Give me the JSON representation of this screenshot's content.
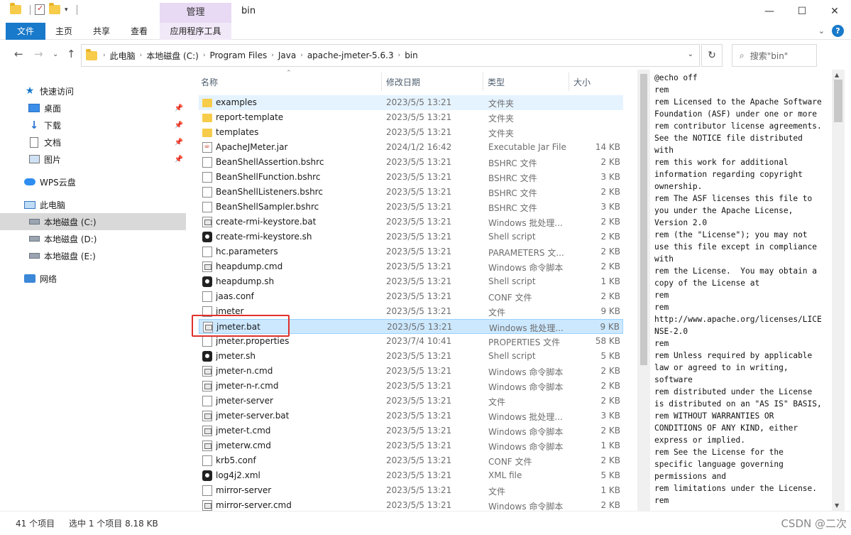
{
  "window": {
    "title": "bin",
    "manage_tab": "管理",
    "controls": {
      "minimize": "—",
      "maximize": "☐",
      "close": "✕"
    }
  },
  "ribbon": {
    "tabs": [
      "文件",
      "主页",
      "共享",
      "查看",
      "应用程序工具"
    ],
    "help": "?"
  },
  "address": {
    "crumbs": [
      "此电脑",
      "本地磁盘 (C:)",
      "Program Files",
      "Java",
      "apache-jmeter-5.6.3",
      "bin"
    ],
    "search_placeholder": "搜索\"bin\""
  },
  "sidebar": {
    "items": [
      {
        "label": "快速访问",
        "icon": "star-icon",
        "pinned": false
      },
      {
        "label": "桌面",
        "icon": "desktop-icon",
        "pinned": true
      },
      {
        "label": "下载",
        "icon": "download-icon",
        "pinned": true
      },
      {
        "label": "文档",
        "icon": "document-icon",
        "pinned": true
      },
      {
        "label": "图片",
        "icon": "picture-icon",
        "pinned": true
      },
      {
        "label": "WPS云盘",
        "icon": "cloud-icon",
        "pinned": false
      },
      {
        "label": "此电脑",
        "icon": "computer-icon",
        "pinned": false
      },
      {
        "label": "本地磁盘 (C:)",
        "icon": "drive-icon",
        "pinned": false
      },
      {
        "label": "本地磁盘 (D:)",
        "icon": "drive-icon",
        "pinned": false
      },
      {
        "label": "本地磁盘 (E:)",
        "icon": "drive-icon",
        "pinned": false
      },
      {
        "label": "网络",
        "icon": "network-icon",
        "pinned": false
      }
    ]
  },
  "columns": {
    "name": "名称",
    "date": "修改日期",
    "type": "类型",
    "size": "大小"
  },
  "files": [
    {
      "name": "examples",
      "date": "2023/5/5 13:21",
      "type": "文件夹",
      "size": "",
      "icon": "folder"
    },
    {
      "name": "report-template",
      "date": "2023/5/5 13:21",
      "type": "文件夹",
      "size": "",
      "icon": "folder"
    },
    {
      "name": "templates",
      "date": "2023/5/5 13:21",
      "type": "文件夹",
      "size": "",
      "icon": "folder"
    },
    {
      "name": "ApacheJMeter.jar",
      "date": "2024/1/2 16:42",
      "type": "Executable Jar File",
      "size": "14 KB",
      "icon": "jar"
    },
    {
      "name": "BeanShellAssertion.bshrc",
      "date": "2023/5/5 13:21",
      "type": "BSHRC 文件",
      "size": "2 KB",
      "icon": "file"
    },
    {
      "name": "BeanShellFunction.bshrc",
      "date": "2023/5/5 13:21",
      "type": "BSHRC 文件",
      "size": "3 KB",
      "icon": "file"
    },
    {
      "name": "BeanShellListeners.bshrc",
      "date": "2023/5/5 13:21",
      "type": "BSHRC 文件",
      "size": "2 KB",
      "icon": "file"
    },
    {
      "name": "BeanShellSampler.bshrc",
      "date": "2023/5/5 13:21",
      "type": "BSHRC 文件",
      "size": "3 KB",
      "icon": "file"
    },
    {
      "name": "create-rmi-keystore.bat",
      "date": "2023/5/5 13:21",
      "type": "Windows 批处理...",
      "size": "2 KB",
      "icon": "bat"
    },
    {
      "name": "create-rmi-keystore.sh",
      "date": "2023/5/5 13:21",
      "type": "Shell script",
      "size": "2 KB",
      "icon": "sh"
    },
    {
      "name": "hc.parameters",
      "date": "2023/5/5 13:21",
      "type": "PARAMETERS 文...",
      "size": "2 KB",
      "icon": "file"
    },
    {
      "name": "heapdump.cmd",
      "date": "2023/5/5 13:21",
      "type": "Windows 命令脚本",
      "size": "2 KB",
      "icon": "bat"
    },
    {
      "name": "heapdump.sh",
      "date": "2023/5/5 13:21",
      "type": "Shell script",
      "size": "1 KB",
      "icon": "sh"
    },
    {
      "name": "jaas.conf",
      "date": "2023/5/5 13:21",
      "type": "CONF 文件",
      "size": "2 KB",
      "icon": "file"
    },
    {
      "name": "jmeter",
      "date": "2023/5/5 13:21",
      "type": "文件",
      "size": "9 KB",
      "icon": "file"
    },
    {
      "name": "jmeter.bat",
      "date": "2023/5/5 13:21",
      "type": "Windows 批处理...",
      "size": "9 KB",
      "icon": "bat",
      "selected": true
    },
    {
      "name": "jmeter.properties",
      "date": "2023/7/4 10:41",
      "type": "PROPERTIES 文件",
      "size": "58 KB",
      "icon": "file"
    },
    {
      "name": "jmeter.sh",
      "date": "2023/5/5 13:21",
      "type": "Shell script",
      "size": "5 KB",
      "icon": "sh"
    },
    {
      "name": "jmeter-n.cmd",
      "date": "2023/5/5 13:21",
      "type": "Windows 命令脚本",
      "size": "2 KB",
      "icon": "bat"
    },
    {
      "name": "jmeter-n-r.cmd",
      "date": "2023/5/5 13:21",
      "type": "Windows 命令脚本",
      "size": "2 KB",
      "icon": "bat"
    },
    {
      "name": "jmeter-server",
      "date": "2023/5/5 13:21",
      "type": "文件",
      "size": "2 KB",
      "icon": "file"
    },
    {
      "name": "jmeter-server.bat",
      "date": "2023/5/5 13:21",
      "type": "Windows 批处理...",
      "size": "3 KB",
      "icon": "bat"
    },
    {
      "name": "jmeter-t.cmd",
      "date": "2023/5/5 13:21",
      "type": "Windows 命令脚本",
      "size": "2 KB",
      "icon": "bat"
    },
    {
      "name": "jmeterw.cmd",
      "date": "2023/5/5 13:21",
      "type": "Windows 命令脚本",
      "size": "1 KB",
      "icon": "bat"
    },
    {
      "name": "krb5.conf",
      "date": "2023/5/5 13:21",
      "type": "CONF 文件",
      "size": "2 KB",
      "icon": "file"
    },
    {
      "name": "log4j2.xml",
      "date": "2023/5/5 13:21",
      "type": "XML file",
      "size": "5 KB",
      "icon": "xml"
    },
    {
      "name": "mirror-server",
      "date": "2023/5/5 13:21",
      "type": "文件",
      "size": "1 KB",
      "icon": "file"
    },
    {
      "name": "mirror-server.cmd",
      "date": "2023/5/5 13:21",
      "type": "Windows 命令脚本",
      "size": "2 KB",
      "icon": "bat"
    }
  ],
  "preview_lines": [
    "@echo off",
    "rem",
    "rem Licensed to the Apache Software",
    "Foundation (ASF) under one or more",
    "rem contributor license agreements.",
    "See the NOTICE file distributed",
    "with",
    "rem this work for additional",
    "information regarding copyright",
    "ownership.",
    "rem The ASF licenses this file to",
    "you under the Apache License,",
    "Version 2.0",
    "rem (the \"License\"); you may not",
    "use this file except in compliance",
    "with",
    "rem the License.  You may obtain a",
    "copy of the License at",
    "rem",
    "rem",
    "http://www.apache.org/licenses/LICE",
    "NSE-2.0",
    "rem",
    "rem Unless required by applicable",
    "law or agreed to in writing,",
    "software",
    "rem distributed under the License",
    "is distributed on an \"AS IS\" BASIS,",
    "rem WITHOUT WARRANTIES OR",
    "CONDITIONS OF ANY KIND, either",
    "express or implied.",
    "rem See the License for the",
    "specific language governing",
    "permissions and",
    "rem limitations under the License.",
    "rem"
  ],
  "status": {
    "count": "41 个项目",
    "selected": "选中 1 个项目  8.18 KB",
    "watermark": "CSDN @二次"
  }
}
